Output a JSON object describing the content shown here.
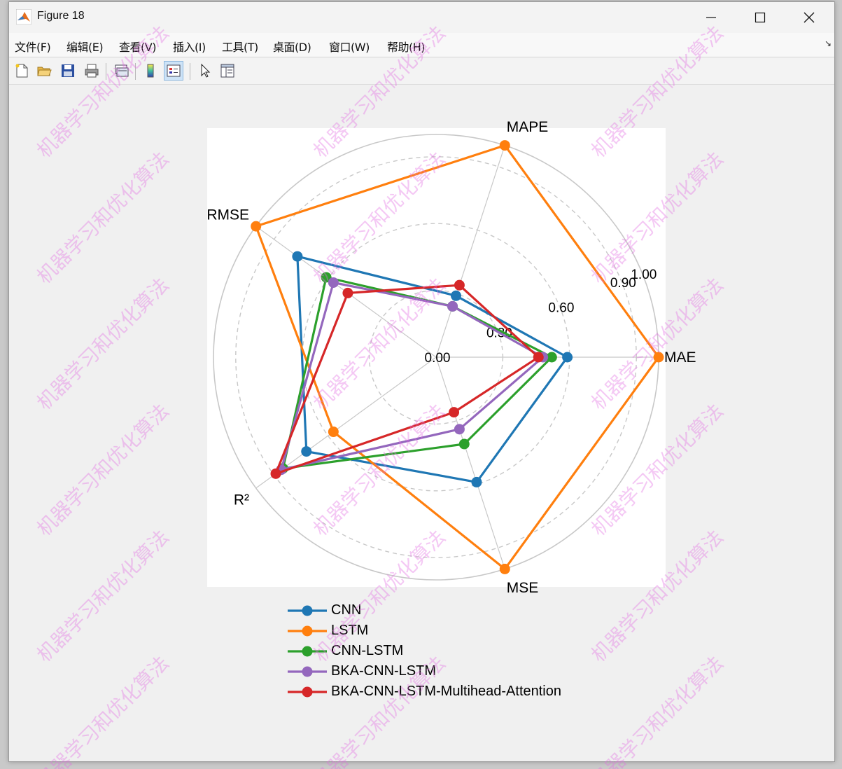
{
  "window": {
    "title": "Figure 18",
    "menu": [
      "文件(F)",
      "编辑(E)",
      "查看(V)",
      "插入(I)",
      "工具(T)",
      "桌面(D)",
      "窗口(W)",
      "帮助(H)"
    ],
    "toolbar_icons": [
      "new-figure-icon",
      "open-file-icon",
      "save-icon",
      "print-icon",
      "link-plot-icon",
      "colorbar-icon",
      "legend-icon",
      "pointer-icon",
      "property-inspector-icon"
    ]
  },
  "watermark_text": "机器学习和优化算法",
  "chart_data": {
    "type": "radar",
    "axes": [
      "MAE",
      "MAPE",
      "RMSE",
      "R²",
      "MSE"
    ],
    "radial_ticks": [
      0.0,
      0.3,
      0.6,
      0.9,
      1.0
    ],
    "radial_tick_labels": [
      "0.00",
      "0.30",
      "0.60",
      "0.90",
      "1.00"
    ],
    "rlim": [
      0,
      1.0
    ],
    "grid": true,
    "legend_position": "below",
    "series": [
      {
        "name": "CNN",
        "color": "#1f77b4",
        "values": [
          0.59,
          0.29,
          0.77,
          0.72,
          0.59
        ]
      },
      {
        "name": "LSTM",
        "color": "#ff7f0e",
        "values": [
          1.0,
          1.0,
          1.0,
          0.57,
          1.0
        ]
      },
      {
        "name": "CNN-LSTM",
        "color": "#2ca02c",
        "values": [
          0.52,
          0.24,
          0.61,
          0.85,
          0.41
        ]
      },
      {
        "name": "BKA-CNN-LSTM",
        "color": "#9467bd",
        "values": [
          0.48,
          0.24,
          0.57,
          0.86,
          0.34
        ]
      },
      {
        "name": "BKA-CNN-LSTM-Multihead-Attention",
        "color": "#d62728",
        "values": [
          0.46,
          0.34,
          0.49,
          0.89,
          0.26
        ]
      }
    ]
  }
}
